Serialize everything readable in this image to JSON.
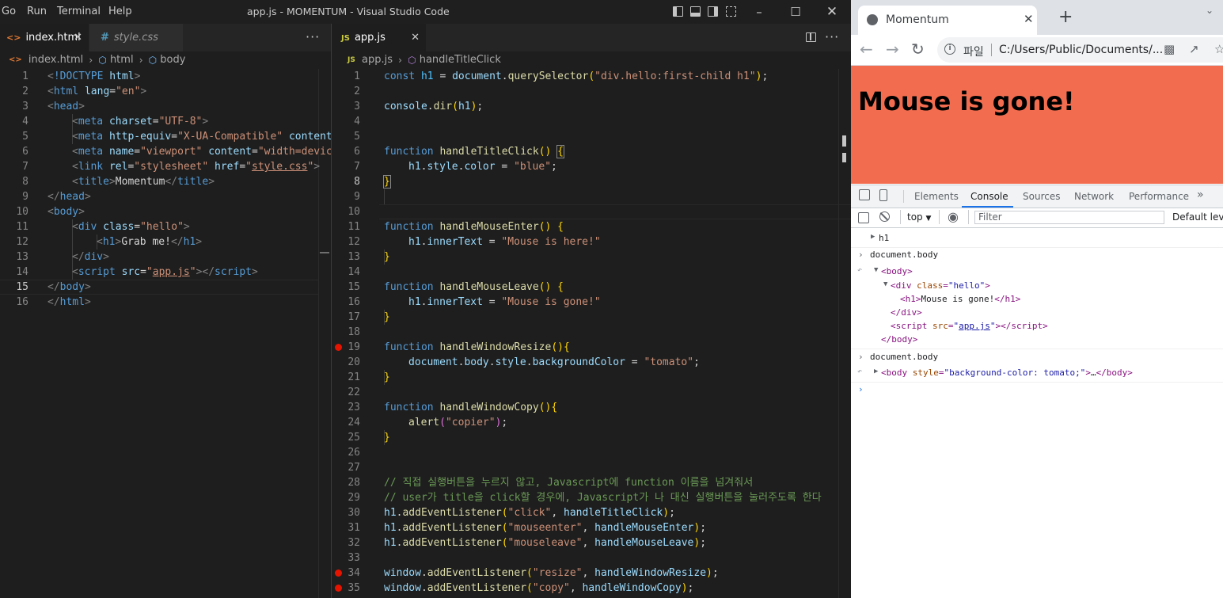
{
  "vscode": {
    "menu": [
      "Go",
      "Run",
      "Terminal",
      "Help"
    ],
    "window_title": "app.js - MOMENTUM - Visual Studio Code",
    "left_pane": {
      "tabs": [
        {
          "icon": "<>",
          "label": "index.html",
          "active": true
        },
        {
          "icon": "#",
          "label": "style.css",
          "active": false
        }
      ],
      "breadcrumb": [
        "index.html",
        "html",
        "body"
      ],
      "current_line": 15
    },
    "right_pane": {
      "tabs": [
        {
          "icon": "JS",
          "label": "app.js",
          "active": true
        }
      ],
      "breadcrumb": [
        "app.js",
        "handleTitleClick"
      ],
      "current_line": 8,
      "breakpoints": [
        19,
        34,
        35
      ]
    }
  },
  "chrome": {
    "tab_title": "Momentum",
    "omnibox_scheme": "파일",
    "omnibox_url": "C:/Users/Public/Documents/...",
    "page_heading": "Mouse is gone!",
    "page_background": "#f26d4f",
    "devtools": {
      "tabs": [
        "Elements",
        "Console",
        "Sources",
        "Network",
        "Performance"
      ],
      "active_tab": "Console",
      "context": "top",
      "filter_placeholder": "Filter",
      "levels": "Default leve",
      "console": {
        "h1_entry": "h1",
        "cmd1": "document.body",
        "cmd2": "document.body",
        "link_text": "app.js"
      }
    }
  }
}
